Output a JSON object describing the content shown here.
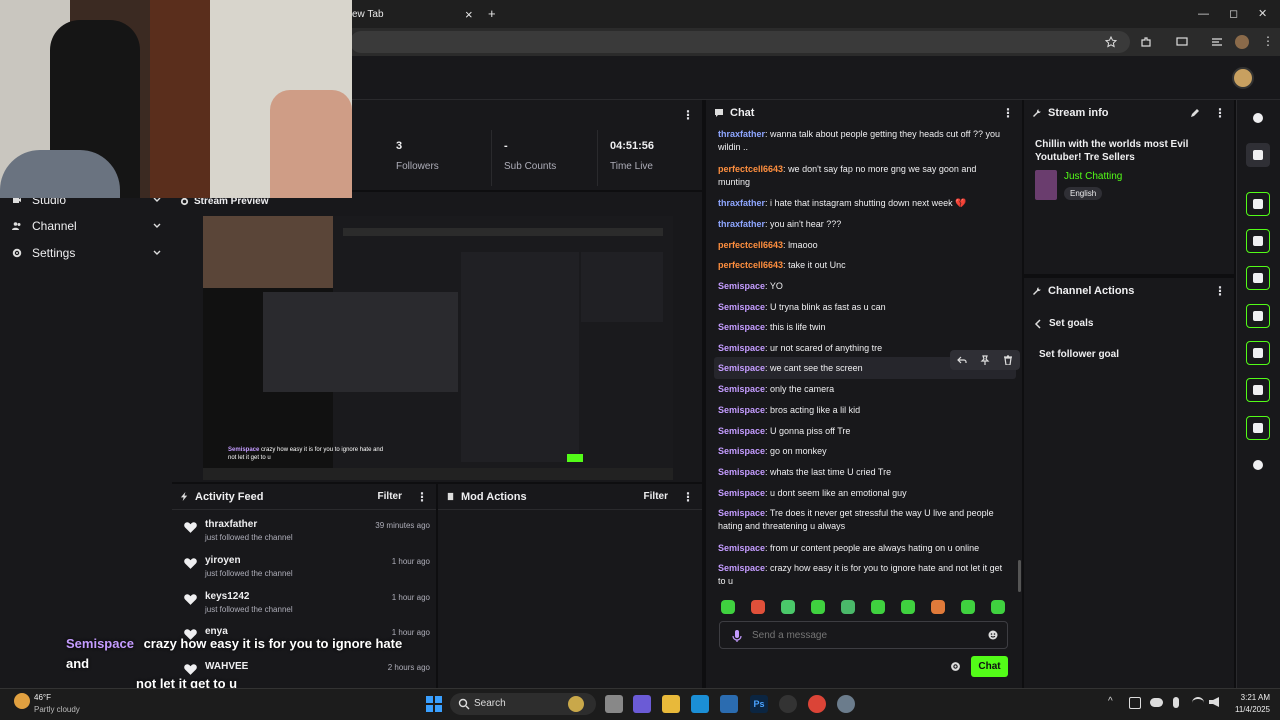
{
  "browser": {
    "tab_title": "ew Tab",
    "tab_close": "×",
    "new_tab": "+",
    "win_min": "—",
    "win_max": "◻",
    "win_close": "✕"
  },
  "nav": {
    "items": [
      {
        "label": "Studio",
        "icon": "video-icon"
      },
      {
        "label": "Channel",
        "icon": "people-icon"
      },
      {
        "label": "Settings",
        "icon": "gear-icon"
      }
    ]
  },
  "stats": [
    {
      "value": "3",
      "label": "Followers"
    },
    {
      "value": "-",
      "label": "Sub Counts"
    },
    {
      "value": "04:51:56",
      "label": "Time Live"
    }
  ],
  "stream_preview": {
    "title": "Stream Preview",
    "overlay_user": "Semispace",
    "overlay_text": "crazy how easy it is for you to ignore hate and not let it get to u"
  },
  "activity_feed": {
    "title": "Activity Feed",
    "filter": "Filter",
    "items": [
      {
        "name": "thraxfather",
        "desc": "just followed the channel",
        "time": "39 minutes ago"
      },
      {
        "name": "yiroyen",
        "desc": "just followed the channel",
        "time": "1 hour ago"
      },
      {
        "name": "keys1242",
        "desc": "just followed the channel",
        "time": "1 hour ago"
      },
      {
        "name": "enya",
        "desc": "",
        "time": "1 hour ago"
      },
      {
        "name": "WAHVEE",
        "desc": "",
        "time": "2 hours ago"
      }
    ]
  },
  "mod_actions": {
    "title": "Mod Actions",
    "filter": "Filter"
  },
  "caption_overlay": {
    "user": "Semispace",
    "text1": "crazy how easy it is for you to ignore hate and",
    "text2": "not let it get to u"
  },
  "chat": {
    "title": "Chat",
    "messages": [
      {
        "user": "thraxfather",
        "kind": "thrax",
        "text": "wanna talk about people getting they heads cut off ?? you wildin .."
      },
      {
        "user": "perfectcell6643",
        "kind": "perf",
        "text": "we don't say fap no more gng we say goon and munting"
      },
      {
        "user": "thraxfather",
        "kind": "thrax",
        "text": "i hate that instagram shutting down next week 💔"
      },
      {
        "user": "thraxfather",
        "kind": "thrax",
        "text": "you ain't hear ???"
      },
      {
        "user": "perfectcell6643",
        "kind": "perf",
        "text": "lmaooo"
      },
      {
        "user": "perfectcell6643",
        "kind": "perf",
        "text": "take it out Unc"
      },
      {
        "user": "Semispace",
        "kind": "semi",
        "text": "YO"
      },
      {
        "user": "Semispace",
        "kind": "semi",
        "text": "U tryna blink as fast as u can"
      },
      {
        "user": "Semispace",
        "kind": "semi",
        "text": "this is life twin"
      },
      {
        "user": "Semispace",
        "kind": "semi",
        "text": "ur not scared of anything tre"
      },
      {
        "user": "Semispace",
        "kind": "semi",
        "text": "we cant see the screen"
      },
      {
        "user": "Semispace",
        "kind": "semi",
        "text": "only the camera"
      },
      {
        "user": "Semispace",
        "kind": "semi",
        "text": "bros acting like a lil kid"
      },
      {
        "user": "Semispace",
        "kind": "semi",
        "text": "U gonna piss off Tre"
      },
      {
        "user": "Semispace",
        "kind": "semi",
        "text": "go on monkey"
      },
      {
        "user": "Semispace",
        "kind": "semi",
        "text": "whats the last time U cried Tre"
      },
      {
        "user": "Semispace",
        "kind": "semi",
        "text": "u dont seem like an emotional guy"
      },
      {
        "user": "Semispace",
        "kind": "semi",
        "text": "Tre does it never get stressful the way U live and people hating and threatening u always"
      },
      {
        "user": "Semispace",
        "kind": "semi",
        "text": "from ur content people are always hating on u online"
      },
      {
        "user": "Semispace",
        "kind": "semi",
        "text": "crazy how easy it is for you to ignore hate and not let it get to u"
      }
    ],
    "placeholder": "Send a message",
    "chat_button": "Chat",
    "sep": ": "
  },
  "stream_info": {
    "title": "Stream info",
    "stream_title": "Chillin with the worlds most Evil Youtuber! Tre Sellers",
    "category": "Just Chatting",
    "language": "English"
  },
  "channel_actions": {
    "title": "Channel Actions",
    "back_label": "Set goals",
    "item": "Set follower goal"
  },
  "taskbar": {
    "weather_temp": "46°F",
    "weather_desc": "Partly cloudy",
    "search": "Search",
    "time": "3:21 AM",
    "date": "11/4/2025"
  },
  "colors": {
    "accent_green": "#53fc18",
    "thrax": "#8ea6ff",
    "perfect": "#ff8f3f",
    "semi": "#c49cff"
  }
}
